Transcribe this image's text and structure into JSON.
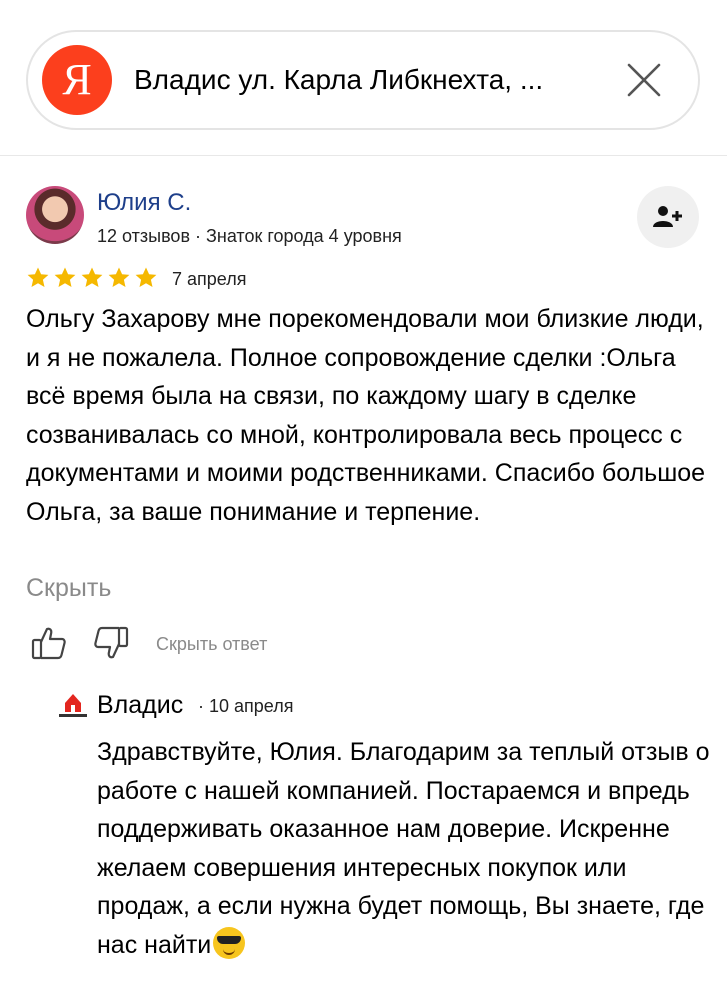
{
  "search": {
    "logo_letter": "Я",
    "query": "Владис ул. Карла Либкнехта, ..."
  },
  "review": {
    "author_name": "Юлия С.",
    "author_meta": "12 отзывов · Знаток города 4 уровня",
    "rating": 5,
    "date": "7 апреля",
    "text": "Ольгу Захарову мне порекомендовали мои близкие люди, и я не пожалела. Полное сопровождение сделки :Ольга всё время была на связи, по каждому шагу в сделке созванивалась со мной, контролировала весь процесс с документами и моими родственниками. Спасибо большое Ольга, за ваше понимание и терпение.",
    "hide_label": "Скрыть"
  },
  "actions": {
    "hide_answer_label": "Скрыть ответ"
  },
  "answer": {
    "company_name": "Владис",
    "date": "· 10 апреля",
    "text": "Здравствуйте, Юлия. Благодарим за теплый отзыв о работе с нашей компанией. Постараемся и впредь поддерживать оказанное нам доверие. Искренне желаем совершения интересных покупок или продаж, а если нужна будет помощь, Вы знаете, где нас найти"
  },
  "colors": {
    "brand_red": "#fc3f1d",
    "link_blue": "#1e3f8a",
    "star_yellow": "#f5b800",
    "muted_gray": "#8a8a8a"
  },
  "icons": [
    "yandex-logo",
    "close-icon",
    "user-avatar",
    "add-user-icon",
    "star-icon",
    "thumbs-up-icon",
    "thumbs-down-icon",
    "vladis-logo",
    "sunglasses-emoji"
  ]
}
